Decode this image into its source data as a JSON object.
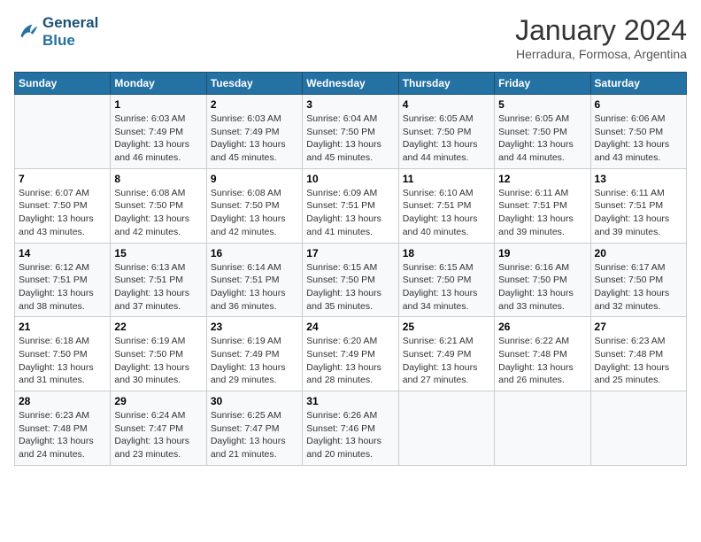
{
  "logo": {
    "line1": "General",
    "line2": "Blue"
  },
  "title": "January 2024",
  "subtitle": "Herradura, Formosa, Argentina",
  "days_header": [
    "Sunday",
    "Monday",
    "Tuesday",
    "Wednesday",
    "Thursday",
    "Friday",
    "Saturday"
  ],
  "weeks": [
    [
      {
        "day": "",
        "sunrise": "",
        "sunset": "",
        "daylight": ""
      },
      {
        "day": "1",
        "sunrise": "Sunrise: 6:03 AM",
        "sunset": "Sunset: 7:49 PM",
        "daylight": "Daylight: 13 hours and 46 minutes."
      },
      {
        "day": "2",
        "sunrise": "Sunrise: 6:03 AM",
        "sunset": "Sunset: 7:49 PM",
        "daylight": "Daylight: 13 hours and 45 minutes."
      },
      {
        "day": "3",
        "sunrise": "Sunrise: 6:04 AM",
        "sunset": "Sunset: 7:50 PM",
        "daylight": "Daylight: 13 hours and 45 minutes."
      },
      {
        "day": "4",
        "sunrise": "Sunrise: 6:05 AM",
        "sunset": "Sunset: 7:50 PM",
        "daylight": "Daylight: 13 hours and 44 minutes."
      },
      {
        "day": "5",
        "sunrise": "Sunrise: 6:05 AM",
        "sunset": "Sunset: 7:50 PM",
        "daylight": "Daylight: 13 hours and 44 minutes."
      },
      {
        "day": "6",
        "sunrise": "Sunrise: 6:06 AM",
        "sunset": "Sunset: 7:50 PM",
        "daylight": "Daylight: 13 hours and 43 minutes."
      }
    ],
    [
      {
        "day": "7",
        "sunrise": "Sunrise: 6:07 AM",
        "sunset": "Sunset: 7:50 PM",
        "daylight": "Daylight: 13 hours and 43 minutes."
      },
      {
        "day": "8",
        "sunrise": "Sunrise: 6:08 AM",
        "sunset": "Sunset: 7:50 PM",
        "daylight": "Daylight: 13 hours and 42 minutes."
      },
      {
        "day": "9",
        "sunrise": "Sunrise: 6:08 AM",
        "sunset": "Sunset: 7:50 PM",
        "daylight": "Daylight: 13 hours and 42 minutes."
      },
      {
        "day": "10",
        "sunrise": "Sunrise: 6:09 AM",
        "sunset": "Sunset: 7:51 PM",
        "daylight": "Daylight: 13 hours and 41 minutes."
      },
      {
        "day": "11",
        "sunrise": "Sunrise: 6:10 AM",
        "sunset": "Sunset: 7:51 PM",
        "daylight": "Daylight: 13 hours and 40 minutes."
      },
      {
        "day": "12",
        "sunrise": "Sunrise: 6:11 AM",
        "sunset": "Sunset: 7:51 PM",
        "daylight": "Daylight: 13 hours and 39 minutes."
      },
      {
        "day": "13",
        "sunrise": "Sunrise: 6:11 AM",
        "sunset": "Sunset: 7:51 PM",
        "daylight": "Daylight: 13 hours and 39 minutes."
      }
    ],
    [
      {
        "day": "14",
        "sunrise": "Sunrise: 6:12 AM",
        "sunset": "Sunset: 7:51 PM",
        "daylight": "Daylight: 13 hours and 38 minutes."
      },
      {
        "day": "15",
        "sunrise": "Sunrise: 6:13 AM",
        "sunset": "Sunset: 7:51 PM",
        "daylight": "Daylight: 13 hours and 37 minutes."
      },
      {
        "day": "16",
        "sunrise": "Sunrise: 6:14 AM",
        "sunset": "Sunset: 7:51 PM",
        "daylight": "Daylight: 13 hours and 36 minutes."
      },
      {
        "day": "17",
        "sunrise": "Sunrise: 6:15 AM",
        "sunset": "Sunset: 7:50 PM",
        "daylight": "Daylight: 13 hours and 35 minutes."
      },
      {
        "day": "18",
        "sunrise": "Sunrise: 6:15 AM",
        "sunset": "Sunset: 7:50 PM",
        "daylight": "Daylight: 13 hours and 34 minutes."
      },
      {
        "day": "19",
        "sunrise": "Sunrise: 6:16 AM",
        "sunset": "Sunset: 7:50 PM",
        "daylight": "Daylight: 13 hours and 33 minutes."
      },
      {
        "day": "20",
        "sunrise": "Sunrise: 6:17 AM",
        "sunset": "Sunset: 7:50 PM",
        "daylight": "Daylight: 13 hours and 32 minutes."
      }
    ],
    [
      {
        "day": "21",
        "sunrise": "Sunrise: 6:18 AM",
        "sunset": "Sunset: 7:50 PM",
        "daylight": "Daylight: 13 hours and 31 minutes."
      },
      {
        "day": "22",
        "sunrise": "Sunrise: 6:19 AM",
        "sunset": "Sunset: 7:50 PM",
        "daylight": "Daylight: 13 hours and 30 minutes."
      },
      {
        "day": "23",
        "sunrise": "Sunrise: 6:19 AM",
        "sunset": "Sunset: 7:49 PM",
        "daylight": "Daylight: 13 hours and 29 minutes."
      },
      {
        "day": "24",
        "sunrise": "Sunrise: 6:20 AM",
        "sunset": "Sunset: 7:49 PM",
        "daylight": "Daylight: 13 hours and 28 minutes."
      },
      {
        "day": "25",
        "sunrise": "Sunrise: 6:21 AM",
        "sunset": "Sunset: 7:49 PM",
        "daylight": "Daylight: 13 hours and 27 minutes."
      },
      {
        "day": "26",
        "sunrise": "Sunrise: 6:22 AM",
        "sunset": "Sunset: 7:48 PM",
        "daylight": "Daylight: 13 hours and 26 minutes."
      },
      {
        "day": "27",
        "sunrise": "Sunrise: 6:23 AM",
        "sunset": "Sunset: 7:48 PM",
        "daylight": "Daylight: 13 hours and 25 minutes."
      }
    ],
    [
      {
        "day": "28",
        "sunrise": "Sunrise: 6:23 AM",
        "sunset": "Sunset: 7:48 PM",
        "daylight": "Daylight: 13 hours and 24 minutes."
      },
      {
        "day": "29",
        "sunrise": "Sunrise: 6:24 AM",
        "sunset": "Sunset: 7:47 PM",
        "daylight": "Daylight: 13 hours and 23 minutes."
      },
      {
        "day": "30",
        "sunrise": "Sunrise: 6:25 AM",
        "sunset": "Sunset: 7:47 PM",
        "daylight": "Daylight: 13 hours and 21 minutes."
      },
      {
        "day": "31",
        "sunrise": "Sunrise: 6:26 AM",
        "sunset": "Sunset: 7:46 PM",
        "daylight": "Daylight: 13 hours and 20 minutes."
      },
      {
        "day": "",
        "sunrise": "",
        "sunset": "",
        "daylight": ""
      },
      {
        "day": "",
        "sunrise": "",
        "sunset": "",
        "daylight": ""
      },
      {
        "day": "",
        "sunrise": "",
        "sunset": "",
        "daylight": ""
      }
    ]
  ]
}
